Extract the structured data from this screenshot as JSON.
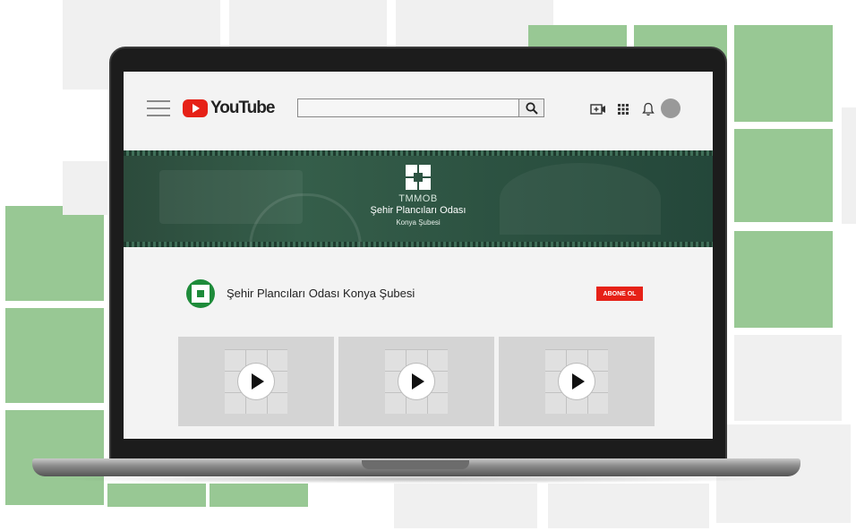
{
  "header": {
    "logo_text": "YouTube",
    "search": {
      "value": "",
      "placeholder": ""
    }
  },
  "banner": {
    "line1": "TMMOB",
    "line2": "Şehir Plancıları Odası",
    "line3": "Konya Şubesi"
  },
  "channel": {
    "name": "Şehir Plancıları Odası Konya Şubesi",
    "subscribe_label": "ABONE OL"
  },
  "videos": [
    {
      "icon": "play-icon"
    },
    {
      "icon": "play-icon"
    },
    {
      "icon": "play-icon"
    }
  ],
  "colors": {
    "accent_red": "#e62117",
    "banner_green": "#2d5342",
    "tile_green": "#98c894",
    "tile_gray": "#f0f0f0"
  }
}
